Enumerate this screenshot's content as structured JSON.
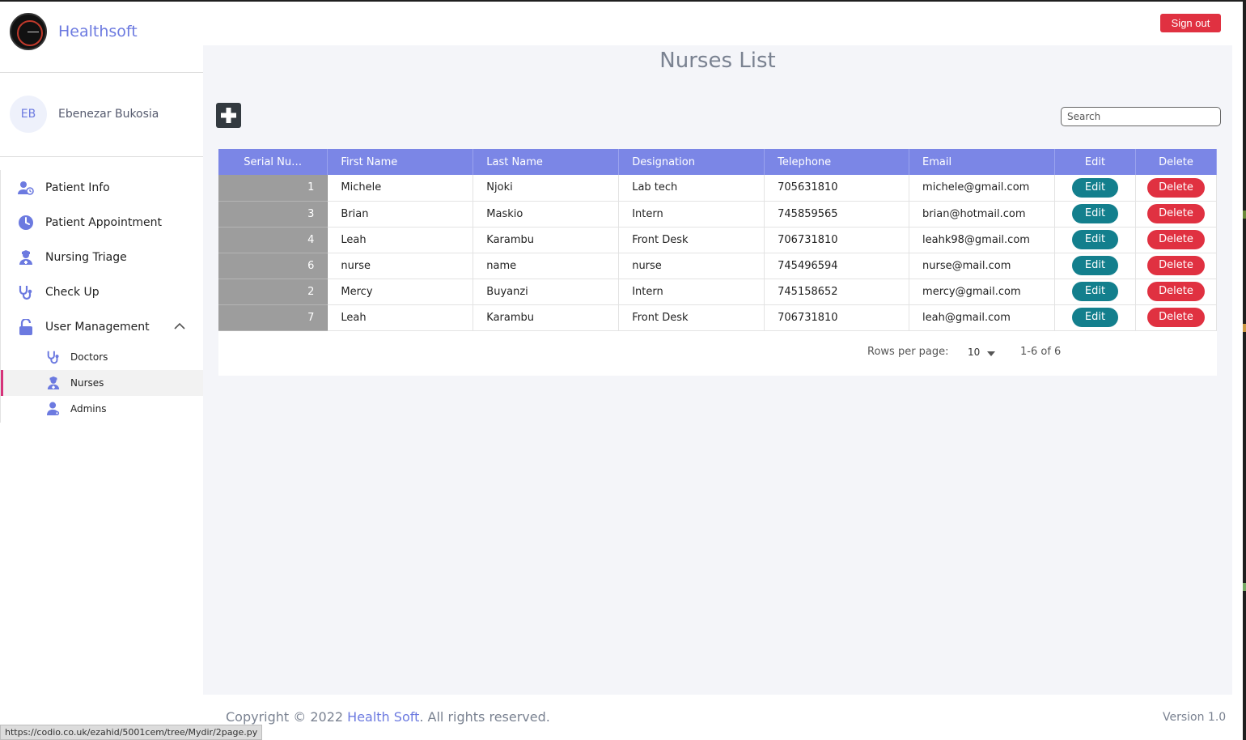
{
  "app": {
    "brand": "Healthsoft",
    "signout_label": "Sign out"
  },
  "user": {
    "initials": "EB",
    "name": "Ebenezar Bukosia"
  },
  "nav": {
    "items": [
      {
        "label": "Patient Info",
        "icon": "patient-info-icon"
      },
      {
        "label": "Patient Appointment",
        "icon": "clock-icon"
      },
      {
        "label": "Nursing Triage",
        "icon": "nurse-icon"
      },
      {
        "label": "Check Up",
        "icon": "stethoscope-icon"
      },
      {
        "label": "User Management",
        "icon": "unlock-icon"
      }
    ],
    "sub_items": [
      {
        "label": "Doctors",
        "icon": "stethoscope-icon"
      },
      {
        "label": "Nurses",
        "icon": "nurse-icon"
      },
      {
        "label": "Admins",
        "icon": "admin-icon"
      }
    ]
  },
  "page": {
    "title": "Nurses List",
    "search_placeholder": "Search"
  },
  "table": {
    "columns": [
      "Serial Nu…",
      "First Name",
      "Last Name",
      "Designation",
      "Telephone",
      "Email",
      "Edit",
      "Delete"
    ],
    "edit_label": "Edit",
    "delete_label": "Delete",
    "rows": [
      {
        "serial": "1",
        "first": "Michele",
        "last": "Njoki",
        "designation": "Lab tech",
        "telephone": "705631810",
        "email": "michele@gmail.com"
      },
      {
        "serial": "3",
        "first": "Brian",
        "last": "Maskio",
        "designation": "Intern",
        "telephone": "745859565",
        "email": "brian@hotmail.com"
      },
      {
        "serial": "4",
        "first": "Leah",
        "last": "Karambu",
        "designation": "Front Desk",
        "telephone": "706731810",
        "email": "leahk98@gmail.com"
      },
      {
        "serial": "6",
        "first": "nurse",
        "last": "name",
        "designation": "nurse",
        "telephone": "745496594",
        "email": "nurse@mail.com"
      },
      {
        "serial": "2",
        "first": "Mercy",
        "last": "Buyanzi",
        "designation": "Intern",
        "telephone": "745158652",
        "email": "mercy@gmail.com"
      },
      {
        "serial": "7",
        "first": "Leah",
        "last": "Karambu",
        "designation": "Front Desk",
        "telephone": "706731810",
        "email": "leah@gmail.com"
      }
    ]
  },
  "pagination": {
    "rows_per_page_label": "Rows per page:",
    "rows_per_page": "10",
    "range": "1-6 of 6"
  },
  "footer": {
    "prefix": "Copyright © 2022 ",
    "brand": "Health Soft",
    "suffix": ". All rights reserved.",
    "version": "Version 1.0"
  },
  "status_url": "https://codio.co.uk/ezahid/5001cem/tree/Mydir/2page.py",
  "colors": {
    "accent": "#6c7ae0",
    "header": "#7b86e6",
    "edit": "#137f8d",
    "delete": "#e03141"
  }
}
